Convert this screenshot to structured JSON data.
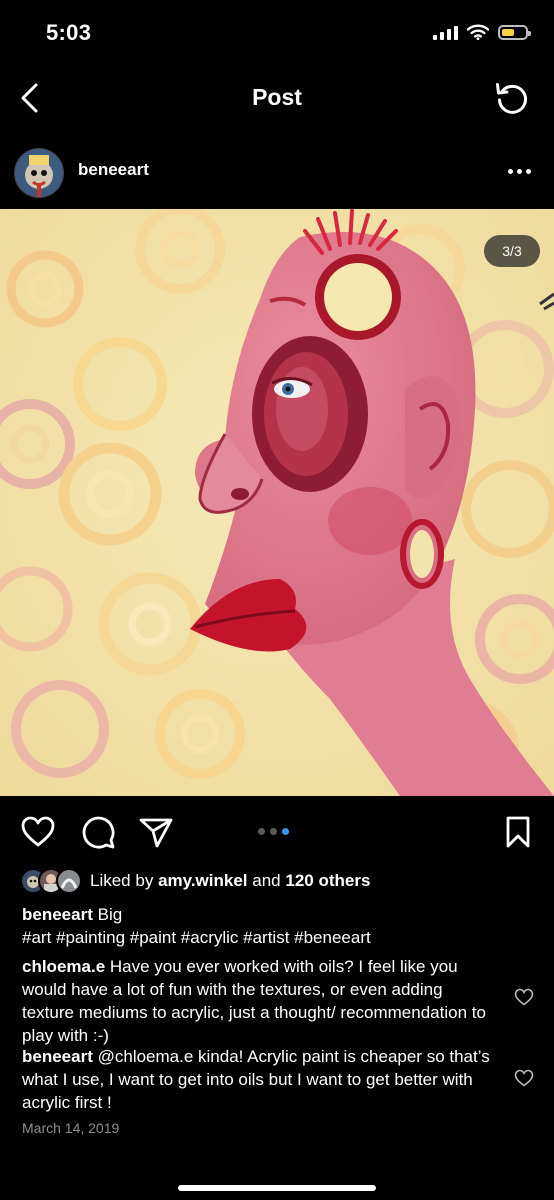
{
  "status_bar": {
    "time": "5:03",
    "battery_level": 0.55,
    "battery_color": "#f7d144"
  },
  "nav": {
    "title": "Post",
    "back_icon": "chevron-left-icon",
    "refresh_icon": "refresh-icon"
  },
  "post": {
    "username": "beneeart",
    "more_icon": "more-options-icon",
    "image_counter": "3/3",
    "carousel": {
      "total": 3,
      "active_index": 2,
      "active_color": "#3897f0"
    }
  },
  "actions": {
    "like_icon": "heart-icon",
    "comment_icon": "comment-icon",
    "share_icon": "send-icon",
    "save_icon": "bookmark-icon"
  },
  "likes": {
    "prefix": "Liked by",
    "user": "amy.winkel",
    "middle": "and",
    "others": "120 others"
  },
  "caption": {
    "username": "beneeart",
    "text": "Big",
    "hashtags": "#art #painting #paint #acrylic #artist #beneeart"
  },
  "comments": [
    {
      "username": "chloema.e",
      "text": "Have you ever worked with oils? I feel like you would have a lot of fun with the textures, or even adding texture mediums to acrylic, just a thought/ recommendation to play with :-)"
    },
    {
      "username": "beneeart",
      "text": "@chloema.e kinda! Acrylic paint is cheaper so that’s what I use, I want to get into oils but I want to get better with acrylic first !"
    }
  ],
  "date": "March 14, 2019"
}
